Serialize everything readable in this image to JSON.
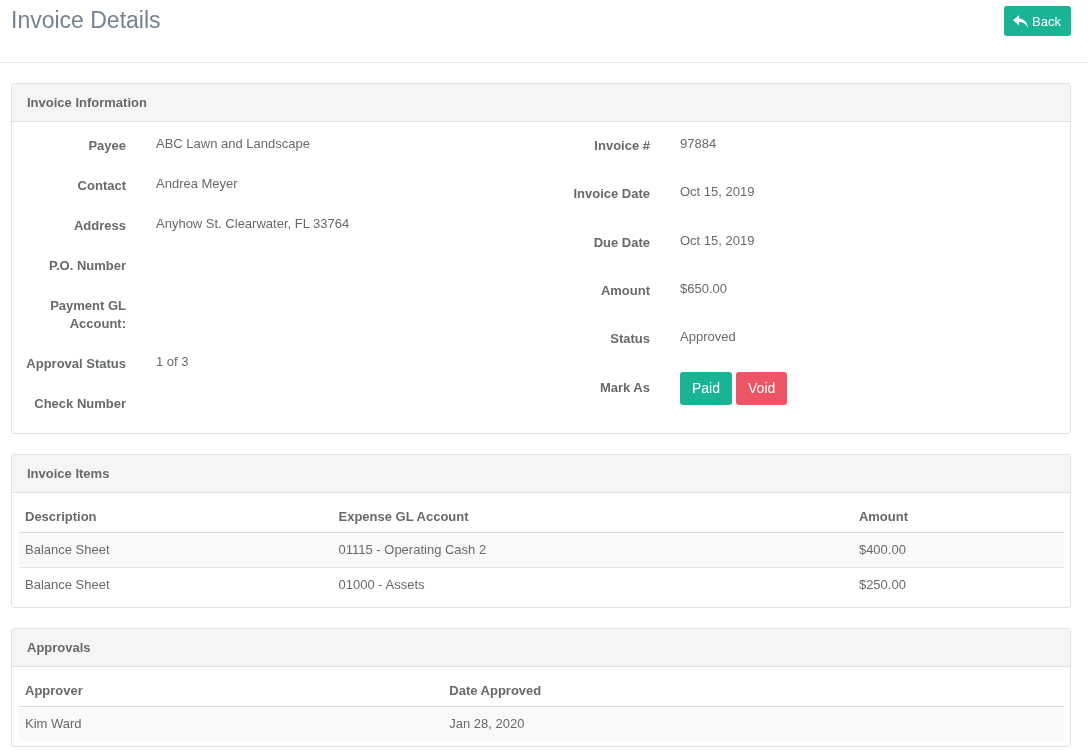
{
  "page": {
    "title": "Invoice Details",
    "back_button": "Back"
  },
  "invoice_information": {
    "title": "Invoice Information",
    "left_fields": [
      {
        "label": "Payee",
        "value": "ABC Lawn and Landscape"
      },
      {
        "label": "Contact",
        "value": "Andrea Meyer"
      },
      {
        "label": "Address",
        "value": "Anyhow St. Clearwater, FL 33764"
      },
      {
        "label": "P.O. Number"
      },
      {
        "label": "Payment GL Account:"
      },
      {
        "label": "Approval Status",
        "value": "1 of 3"
      },
      {
        "label": "Check Number"
      }
    ],
    "right_fields": [
      {
        "kind": "text",
        "label": "Invoice #",
        "value": "97884"
      },
      {
        "kind": "text",
        "label": "Invoice Date",
        "value": "Oct 15, 2019"
      },
      {
        "kind": "text",
        "label": "Due Date",
        "value": "Oct 15, 2019"
      },
      {
        "kind": "text",
        "label": "Amount",
        "value": "$650.00"
      },
      {
        "kind": "text",
        "label": "Status",
        "value": "Approved"
      },
      {
        "kind": "actions",
        "label": "Mark As",
        "buttons": [
          {
            "label": "Paid",
            "kind": "success"
          },
          {
            "label": "Void",
            "kind": "danger"
          }
        ]
      }
    ]
  },
  "invoice_items": {
    "title": "Invoice Items",
    "columns": [
      "Description",
      "Expense GL Account",
      "Amount"
    ],
    "rows": [
      [
        "Balance Sheet",
        "01115 - Operating Cash 2",
        "$400.00"
      ],
      [
        "Balance Sheet",
        "01000 - Assets",
        "$250.00"
      ]
    ]
  },
  "approvals": {
    "title": "Approvals",
    "columns": [
      "Approver",
      "Date Approved"
    ],
    "rows": [
      [
        "Kim Ward",
        "Jan 28, 2020"
      ]
    ]
  }
}
